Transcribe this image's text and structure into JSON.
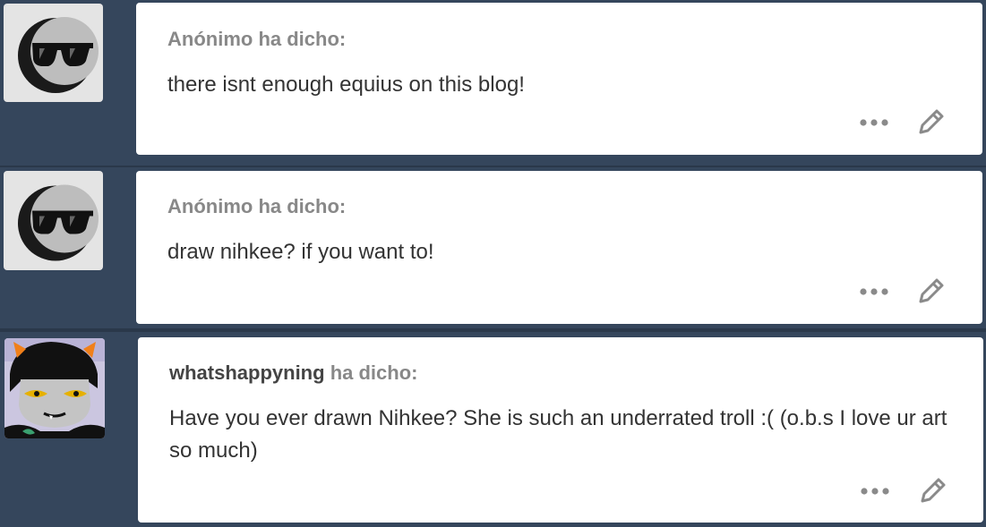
{
  "posts": [
    {
      "avatar_icon": "sunglasses-moon-avatar-icon",
      "asker": "Anónimo",
      "asked_suffix": "ha dicho:",
      "question": "there isnt enough equius on this blog!"
    },
    {
      "avatar_icon": "sunglasses-moon-avatar-icon",
      "asker": "Anónimo",
      "asked_suffix": "ha dicho:",
      "question": "draw nihkee? if you want to!"
    },
    {
      "avatar_icon": "troll-avatar-icon",
      "asker": "whatshappyning",
      "asked_suffix": "ha dicho:",
      "question": "Have you ever drawn Nihkee? She is such an underrated troll :( (o.b.s I love ur art so much)"
    }
  ],
  "actions": {
    "more_icon": "more-options-icon",
    "edit_icon": "pencil-edit-icon"
  },
  "colors": {
    "background": "#35465c",
    "card": "#ffffff",
    "asker_text": "#888888",
    "username_text": "#444444",
    "question_text": "#333333",
    "icon_gray": "#8a8a8a"
  }
}
